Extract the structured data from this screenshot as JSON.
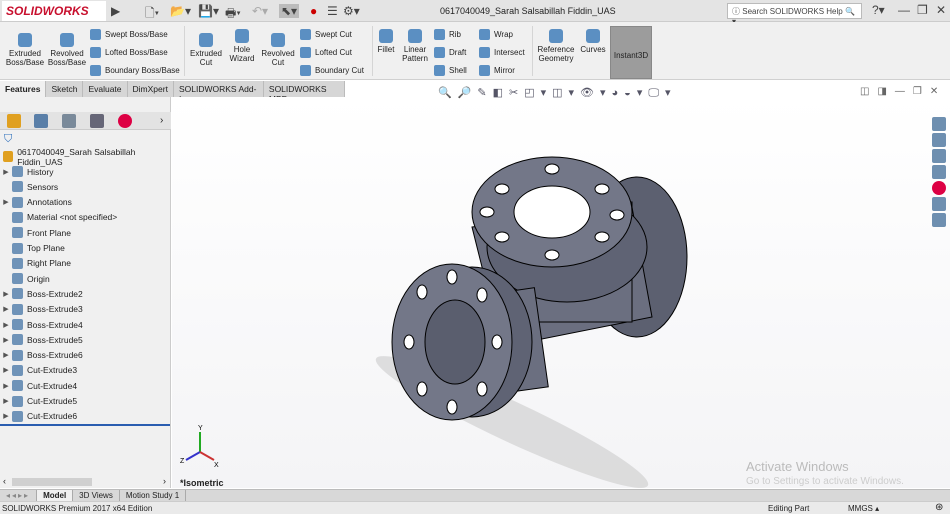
{
  "app": {
    "logo": "SOLIDWORKS",
    "document_title": "0617040049_Sarah Salsabillah Fiddin_UAS",
    "help_search_placeholder": "Search SOLIDWORKS Help"
  },
  "ribbon": {
    "extruded_boss": "Extruded Boss/Base",
    "revolved_boss": "Revolved Boss/Base",
    "swept_boss": "Swept Boss/Base",
    "lofted_boss": "Lofted Boss/Base",
    "boundary_boss": "Boundary Boss/Base",
    "extruded_cut": "Extruded Cut",
    "hole_wizard": "Hole Wizard",
    "revolved_cut": "Revolved Cut",
    "swept_cut": "Swept Cut",
    "lofted_cut": "Lofted Cut",
    "boundary_cut": "Boundary Cut",
    "fillet": "Fillet",
    "linear_pattern": "Linear Pattern",
    "rib": "Rib",
    "draft": "Draft",
    "shell": "Shell",
    "wrap": "Wrap",
    "intersect": "Intersect",
    "mirror": "Mirror",
    "reference_geometry": "Reference Geometry",
    "curves": "Curves",
    "instant3d": "Instant3D"
  },
  "tabs": [
    "Features",
    "Sketch",
    "Evaluate",
    "DimXpert",
    "SOLIDWORKS Add-Ins",
    "SOLIDWORKS MBD"
  ],
  "tree": {
    "root": "0617040049_Sarah Salsabillah Fiddin_UAS",
    "items": [
      {
        "label": "History",
        "arrow": true
      },
      {
        "label": "Sensors",
        "arrow": false
      },
      {
        "label": "Annotations",
        "arrow": true
      },
      {
        "label": "Material <not specified>",
        "arrow": false
      },
      {
        "label": "Front Plane",
        "arrow": false
      },
      {
        "label": "Top Plane",
        "arrow": false
      },
      {
        "label": "Right Plane",
        "arrow": false
      },
      {
        "label": "Origin",
        "arrow": false
      },
      {
        "label": "Boss-Extrude2",
        "arrow": true
      },
      {
        "label": "Boss-Extrude3",
        "arrow": true
      },
      {
        "label": "Boss-Extrude4",
        "arrow": true
      },
      {
        "label": "Boss-Extrude5",
        "arrow": true
      },
      {
        "label": "Boss-Extrude6",
        "arrow": true
      },
      {
        "label": "Cut-Extrude3",
        "arrow": true
      },
      {
        "label": "Cut-Extrude4",
        "arrow": true
      },
      {
        "label": "Cut-Extrude5",
        "arrow": true
      },
      {
        "label": "Cut-Extrude6",
        "arrow": true
      }
    ]
  },
  "viewport": {
    "view_label": "*Isometric",
    "watermark_title": "Activate Windows",
    "watermark_sub": "Go to Settings to activate Windows.",
    "triad": {
      "x": "X",
      "y": "Y",
      "z": "Z"
    }
  },
  "bottom_tabs": [
    "Model",
    "3D Views",
    "Motion Study 1"
  ],
  "status": {
    "edition": "SOLIDWORKS Premium 2017 x64 Edition",
    "mode": "Editing Part",
    "units": "MMGS"
  }
}
